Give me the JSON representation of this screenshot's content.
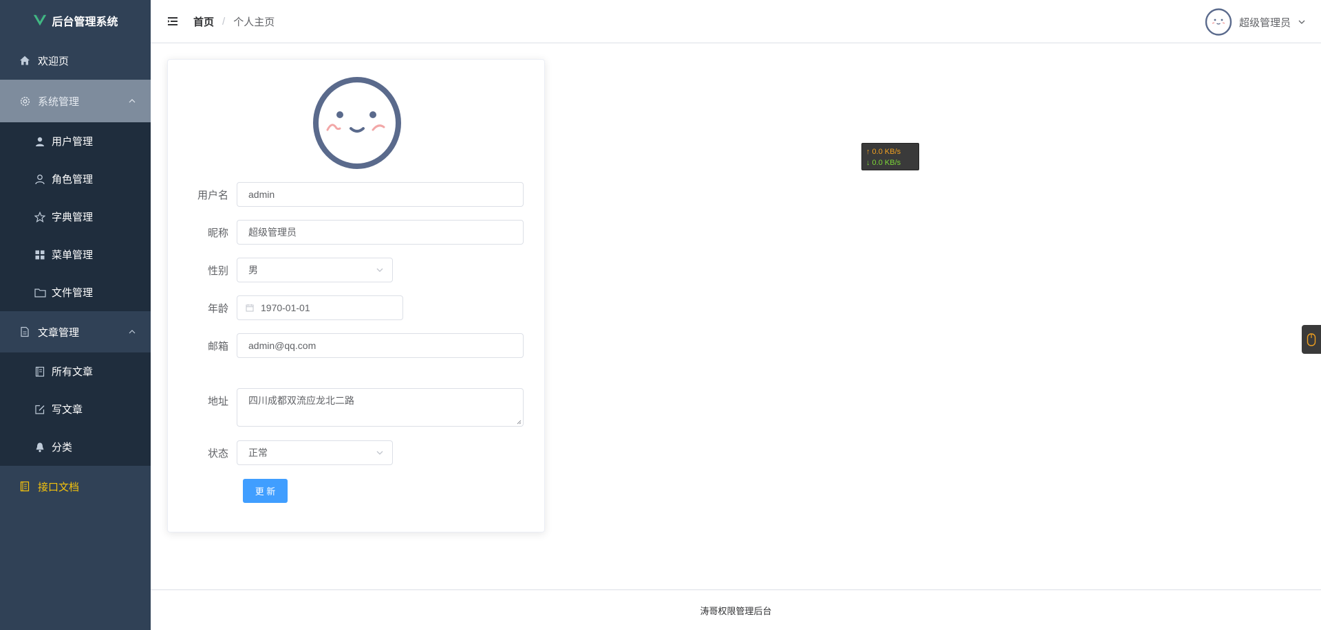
{
  "app": {
    "title": "后台管理系统"
  },
  "sidebar": {
    "items": [
      {
        "label": "欢迎页",
        "icon": "home-icon"
      },
      {
        "label": "系统管理",
        "icon": "gear-icon",
        "expanded": true,
        "children": [
          {
            "label": "用户管理",
            "icon": "user-filled-icon"
          },
          {
            "label": "角色管理",
            "icon": "user-outline-icon"
          },
          {
            "label": "字典管理",
            "icon": "star-icon"
          },
          {
            "label": "菜单管理",
            "icon": "grid-icon"
          },
          {
            "label": "文件管理",
            "icon": "folder-icon"
          }
        ]
      },
      {
        "label": "文章管理",
        "icon": "document-icon",
        "expanded": true,
        "children": [
          {
            "label": "所有文章",
            "icon": "notebook-icon"
          },
          {
            "label": "写文章",
            "icon": "edit-icon"
          },
          {
            "label": "分类",
            "icon": "bell-icon"
          }
        ]
      },
      {
        "label": "接口文档",
        "icon": "api-doc-icon"
      }
    ]
  },
  "header": {
    "breadcrumb": {
      "home": "首页",
      "separator": "/",
      "current": "个人主页"
    },
    "user": {
      "name": "超级管理员"
    }
  },
  "profile": {
    "fields": {
      "username": {
        "label": "用户名",
        "value": "admin"
      },
      "nickname": {
        "label": "昵称",
        "value": "超级管理员"
      },
      "gender": {
        "label": "性别",
        "value": "男"
      },
      "age": {
        "label": "年龄",
        "value": "1970-01-01"
      },
      "email": {
        "label": "邮箱",
        "value": "admin@qq.com"
      },
      "address": {
        "label": "地址",
        "value": "四川成都双流应龙北二路"
      },
      "status": {
        "label": "状态",
        "value": "正常"
      }
    },
    "update_button": "更 新"
  },
  "speed_widget": {
    "up": "↑ 0.0 KB/s",
    "down": "↓ 0.0 KB/s"
  },
  "footer": {
    "text": "涛哥权限管理后台"
  },
  "colors": {
    "sidebar_bg": "#304156",
    "primary": "#409eff",
    "api_item": "#f4c20d",
    "avatar_stroke": "#5a6a8c"
  }
}
